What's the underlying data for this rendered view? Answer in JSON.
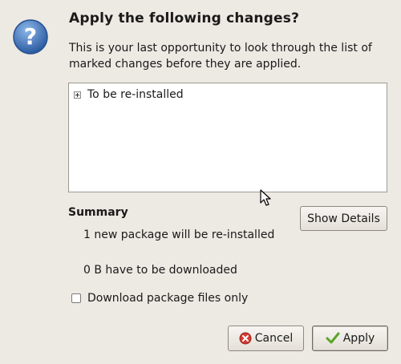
{
  "dialog": {
    "title": "Apply the following changes?",
    "description": "This is your last opportunity to look through the list of marked changes before they are applied."
  },
  "changes_tree": {
    "rows": [
      {
        "label": "To be re-installed"
      }
    ]
  },
  "summary": {
    "heading": "Summary",
    "line1": "1 new package will be re-installed",
    "line2": "0  B have to be downloaded",
    "show_details_label": "Show Details"
  },
  "options": {
    "download_only_label": "Download package files only",
    "download_only_checked": false
  },
  "buttons": {
    "cancel_label": "Cancel",
    "apply_label": "Apply"
  },
  "icons": {
    "dialog_icon": "question-icon",
    "cancel_icon": "cancel-icon",
    "apply_icon": "checkmark-icon",
    "expander_icon": "expander-plus-icon",
    "cursor_icon": "mouse-pointer-icon"
  },
  "colors": {
    "background": "#ede9e3",
    "question_blue": "#3b6fb6",
    "cancel_red": "#d13b33",
    "apply_green": "#5aa528"
  }
}
